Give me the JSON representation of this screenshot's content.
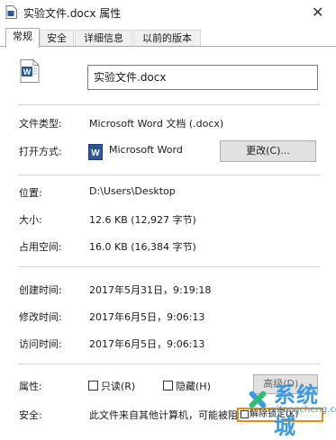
{
  "window": {
    "title": "实验文件.docx 属性",
    "close_glyph": "✕"
  },
  "tabs": [
    {
      "label": "常规",
      "active": true
    },
    {
      "label": "安全"
    },
    {
      "label": "详细信息"
    },
    {
      "label": "以前的版本"
    }
  ],
  "general": {
    "file_name": "实验文件.docx",
    "icon_letter": "W",
    "file_type_label": "文件类型:",
    "file_type_value": "Microsoft Word 文档 (.docx)",
    "open_with_label": "打开方式:",
    "open_with_value": "Microsoft Word",
    "change_button": "更改(C)...",
    "location_label": "位置:",
    "location_value": "D:\\Users\\Desktop",
    "size_label": "大小:",
    "size_value": "12.6 KB (12,927 字节)",
    "disk_size_label": "占用空间:",
    "disk_size_value": "16.0 KB (16,384 字节)",
    "created_label": "创建时间:",
    "created_value": "2017年5月31日，9:19:18",
    "modified_label": "修改时间:",
    "modified_value": "2017年6月5日，9:06:13",
    "accessed_label": "访问时间:",
    "accessed_value": "2017年6月5日，9:06:13",
    "attributes_label": "属性:",
    "readonly_label": "只读(R)",
    "hidden_label": "隐藏(H)",
    "advanced_button": "高级(D)...",
    "security_label": "安全:",
    "security_text": "此文件来自其他计算机，可能被阻",
    "unblock_label": "解除锁定(K)"
  },
  "watermark": {
    "brand": "系统城",
    "url": "xitongcheng.com"
  },
  "colors": {
    "word_blue": "#2b579a",
    "watermark_blue": "#3b9ae1",
    "highlight_orange": "#e68a1a"
  }
}
